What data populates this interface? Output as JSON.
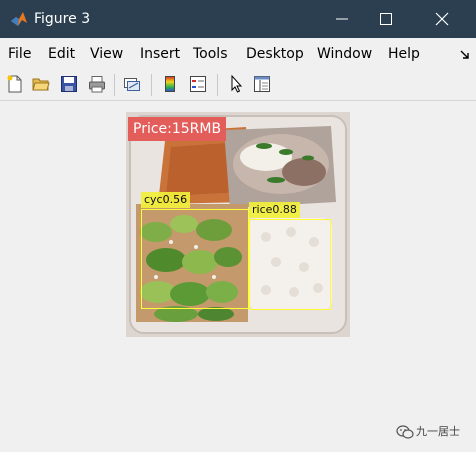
{
  "window": {
    "title": "Figure 3",
    "app_icon": "matlab-logo-icon",
    "controls": [
      "minimize-icon",
      "maximize-icon",
      "close-icon"
    ]
  },
  "menu": {
    "items": [
      "File",
      "Edit",
      "View",
      "Insert",
      "Tools",
      "Desktop",
      "Window",
      "Help"
    ],
    "dock_arrow_icon": "dock-arrow-icon"
  },
  "toolbar": {
    "icons": [
      "new-figure-icon",
      "open-folder-icon",
      "save-icon",
      "print-icon",
      "link-plot-icon",
      "insert-colorbar-icon",
      "insert-legend-icon",
      "pointer-icon",
      "property-inspector-icon"
    ]
  },
  "figure": {
    "price_label": "Price:15RMB",
    "detections": [
      {
        "label": "cyc0.56",
        "class": "cyc",
        "score": 0.56
      },
      {
        "label": "rice0.88",
        "class": "rice",
        "score": 0.88
      }
    ],
    "colors": {
      "price_bg": "#e35d5b",
      "detection_box": "#ffff33",
      "detection_label_bg": "#f2ef3c",
      "titlebar": "#2b3f51"
    }
  },
  "watermark": {
    "text": "九一居士",
    "icon": "wechat-icon"
  }
}
